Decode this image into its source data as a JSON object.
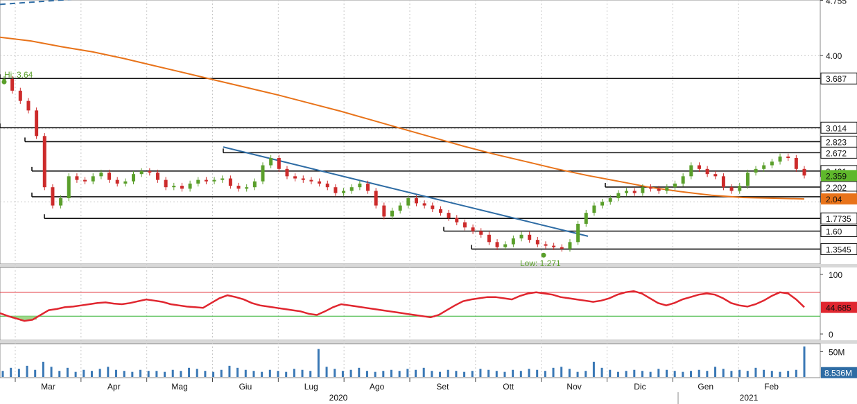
{
  "chart_data": [
    {
      "type": "line",
      "panel": "price",
      "price_axis_ticks": [
        "4.755",
        "4.00"
      ],
      "ylim": [
        1.15,
        4.76
      ],
      "hi_label": "Hi: 3.64",
      "low_label": "Low: 1.271",
      "hi_value": 3.64,
      "low_value": 1.271,
      "horizontal_levels": [
        {
          "label": "3.687",
          "value": 3.687
        },
        {
          "label": "3.014",
          "value": 3.014
        },
        {
          "label": "2.823",
          "value": 2.823
        },
        {
          "label": "2.672",
          "value": 2.672
        },
        {
          "label": "2.421",
          "value": 2.421
        },
        {
          "label": "2.202",
          "value": 2.202
        },
        {
          "label": "2.07",
          "value": 2.07
        },
        {
          "label": "1.7735",
          "value": 1.7735
        },
        {
          "label": "1.60",
          "value": 1.6
        },
        {
          "label": "1.3545",
          "value": 1.3545
        }
      ],
      "last_price_label": "2.359",
      "last_price": 2.359,
      "ma_label": "2.04",
      "ma_value": 2.04,
      "series": [
        {
          "values": [
            3.68,
            3.52,
            3.38,
            3.25,
            2.9,
            2.2,
            1.95,
            2.05,
            2.35,
            2.3,
            2.28,
            2.35,
            2.4,
            2.3,
            2.25,
            2.28,
            2.38,
            2.42,
            2.4,
            2.3,
            2.2,
            2.22,
            2.18,
            2.25,
            2.3,
            2.28,
            2.3,
            2.32,
            2.22,
            2.18,
            2.2,
            2.28,
            2.5,
            2.6,
            2.45,
            2.35,
            2.32,
            2.3,
            2.28,
            2.25,
            2.2,
            2.12,
            2.15,
            2.2,
            2.25,
            2.15,
            1.95,
            1.8,
            1.88,
            1.95,
            2.05,
            1.98,
            1.95,
            1.9,
            1.85,
            1.78,
            1.72,
            1.65,
            1.6,
            1.55,
            1.45,
            1.38,
            1.42,
            1.5,
            1.55,
            1.48,
            1.42,
            1.4,
            1.38,
            1.36,
            1.45,
            1.7,
            1.85,
            1.95,
            2.0,
            2.05,
            2.12,
            2.15,
            2.12,
            2.2,
            2.18,
            2.15,
            2.2,
            2.25,
            2.35,
            2.5,
            2.45,
            2.38,
            2.35,
            2.2,
            2.15,
            2.22,
            2.4,
            2.45,
            2.5,
            2.55,
            2.62,
            2.6,
            2.45,
            2.36
          ]
        },
        {
          "values": [
            4.25,
            4.2,
            4.12,
            4.05,
            3.96,
            3.86,
            3.76,
            3.66,
            3.56,
            3.46,
            3.35,
            3.24,
            3.12,
            3.0,
            2.88,
            2.76,
            2.65,
            2.55,
            2.45,
            2.36,
            2.28,
            2.2,
            2.14,
            2.09,
            2.06,
            2.05,
            2.04
          ]
        }
      ]
    },
    {
      "type": "line",
      "panel": "rsi",
      "ticks": [
        "100",
        "0"
      ],
      "ylim": [
        0,
        100
      ],
      "overbought": 70,
      "oversold": 30,
      "last_label": "44.685",
      "last_value": 44.685,
      "series": [
        {
          "values": [
            35,
            30,
            26,
            22,
            24,
            32,
            40,
            42,
            45,
            46,
            48,
            50,
            52,
            53,
            51,
            50,
            52,
            55,
            58,
            56,
            54,
            50,
            48,
            46,
            45,
            44,
            52,
            60,
            65,
            62,
            58,
            52,
            48,
            46,
            44,
            42,
            40,
            38,
            34,
            32,
            38,
            45,
            50,
            48,
            46,
            44,
            42,
            40,
            38,
            36,
            34,
            32,
            30,
            28,
            32,
            40,
            48,
            55,
            58,
            60,
            62,
            62,
            60,
            58,
            64,
            68,
            70,
            68,
            66,
            62,
            60,
            58,
            56,
            54,
            56,
            60,
            66,
            70,
            72,
            68,
            60,
            52,
            48,
            52,
            58,
            62,
            66,
            68,
            66,
            60,
            52,
            48,
            46,
            50,
            56,
            64,
            70,
            68,
            58,
            45
          ]
        }
      ]
    },
    {
      "type": "bar",
      "panel": "volume",
      "ticks": [
        "50M"
      ],
      "ylim": [
        0,
        60
      ],
      "last_label": "8.536M",
      "last_value": 8.536,
      "values": [
        12,
        18,
        16,
        22,
        14,
        30,
        20,
        12,
        18,
        10,
        14,
        12,
        16,
        20,
        14,
        12,
        10,
        14,
        12,
        12,
        10,
        14,
        12,
        18,
        16,
        12,
        10,
        14,
        22,
        18,
        14,
        12,
        10,
        14,
        12,
        10,
        16,
        14,
        12,
        55,
        20,
        16,
        12,
        14,
        18,
        12,
        10,
        12,
        14,
        12,
        16,
        14,
        18,
        12,
        10,
        14,
        12,
        10,
        12,
        16,
        14,
        12,
        10,
        14,
        12,
        16,
        14,
        12,
        18,
        20,
        16,
        10,
        12,
        30,
        18,
        14,
        10,
        12,
        14,
        12,
        10,
        16,
        14,
        12,
        10,
        12,
        14,
        12,
        20,
        16,
        12,
        14,
        12,
        18,
        14,
        12,
        10,
        12,
        14,
        60
      ]
    }
  ],
  "x_axis": {
    "months": [
      "Mar",
      "Apr",
      "Mag",
      "Giu",
      "Lug",
      "Ago",
      "Set",
      "Ott",
      "Nov",
      "Dic",
      "Gen",
      "Feb"
    ],
    "years": [
      "2020",
      "2021"
    ]
  },
  "colors": {
    "up": "#5a9f2b",
    "down": "#cc2b2b",
    "ma": "#e8731a",
    "trend": "#2e6ca4",
    "rsi": "#e0262f",
    "rsi_fill": "#9fd88a",
    "volume": "#3a78b5",
    "last_price_bg": "#5fb82b",
    "ma_label_bg": "#e8731a",
    "volume_label_bg": "#2e6ca4"
  }
}
